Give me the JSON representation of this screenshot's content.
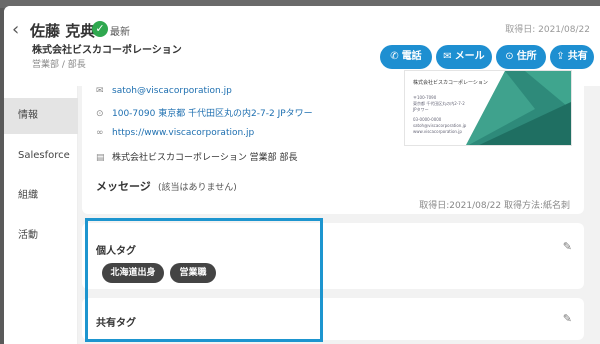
{
  "header": {
    "back_icon": "chevron-left-icon",
    "name": "佐藤 克典",
    "latest_label": "最新",
    "company": "株式会社ビスカコーポレーション",
    "department_title": "営業部 / 部長",
    "acquired_date": "取得日: 2021/08/22",
    "actions": [
      {
        "label": "電話",
        "icon": "phone-icon"
      },
      {
        "label": "メール",
        "icon": "mail-icon"
      },
      {
        "label": "住所",
        "icon": "location-pin-icon"
      },
      {
        "label": "共有",
        "icon": "share-icon"
      }
    ]
  },
  "sidebar": {
    "items": [
      {
        "label": "情報",
        "active": true
      },
      {
        "label": "Salesforce",
        "active": false
      },
      {
        "label": "組織",
        "active": false
      },
      {
        "label": "活動",
        "active": false
      }
    ]
  },
  "details": {
    "email": "satoh@viscacorporation.jp",
    "address": "100-7090 東京都 千代田区丸の内2-7-2 JPタワー",
    "website": "https://www.viscacorporation.jp",
    "org": "株式会社ビスカコーポレーション 営業部 部長",
    "message_label": "メッセージ",
    "message_value": "(該当はありません)",
    "acquired_method": "取得日:2021/08/22 取得方法:紙名刺"
  },
  "business_card": {
    "company": "株式会社ビスカコーポレーション",
    "lines": [
      "〒100-7090",
      "東京都 千代田区丸の内2-7-2",
      "JPタワー",
      "03-0000-0000",
      "satoh@viscacorporation.jp",
      "www.viscacorporation.jp"
    ]
  },
  "personal_tags": {
    "title": "個人タグ",
    "tags": [
      "北海道出身",
      "営業職"
    ]
  },
  "shared_tags": {
    "title": "共有タグ"
  },
  "colors": {
    "accent": "#1e8fd1",
    "highlight_border": "#1d95cf",
    "verified": "#2fa84f"
  }
}
